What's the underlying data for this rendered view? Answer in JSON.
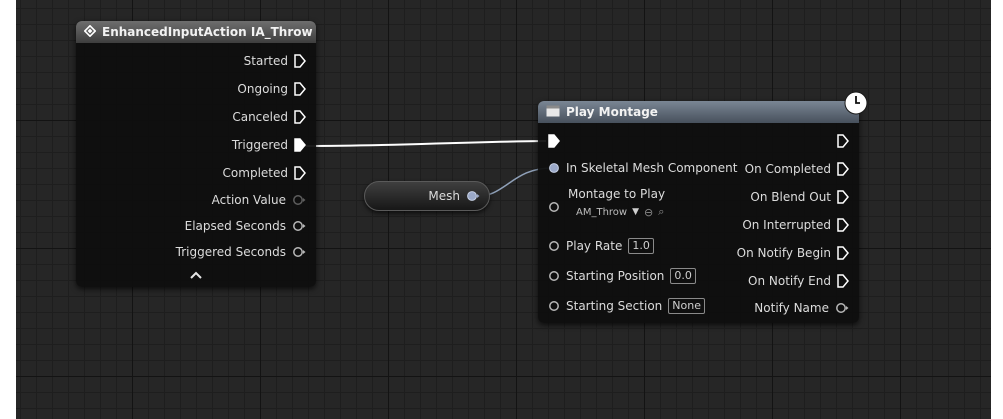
{
  "enhanced_input_node": {
    "title": "EnhancedInputAction IA_Throw",
    "exec_outputs": [
      {
        "label": "Started",
        "connected": false
      },
      {
        "label": "Ongoing",
        "connected": false
      },
      {
        "label": "Canceled",
        "connected": false
      },
      {
        "label": "Triggered",
        "connected": true
      },
      {
        "label": "Completed",
        "connected": false
      }
    ],
    "data_outputs": [
      {
        "label": "Action Value"
      },
      {
        "label": "Elapsed Seconds"
      },
      {
        "label": "Triggered Seconds"
      }
    ],
    "collapse_icon": "chevron-up-icon"
  },
  "mesh_node": {
    "label": "Mesh"
  },
  "play_montage_node": {
    "title": "Play Montage",
    "inputs": {
      "skeletal_mesh": "In Skeletal Mesh Component",
      "montage": {
        "label": "Montage to Play",
        "value": "AM_Throw"
      },
      "play_rate": {
        "label": "Play Rate",
        "value": "1.0"
      },
      "starting_position": {
        "label": "Starting Position",
        "value": "0.0"
      },
      "starting_section": {
        "label": "Starting Section",
        "value": "None"
      }
    },
    "outputs": [
      {
        "label": "On Completed"
      },
      {
        "label": "On Blend Out"
      },
      {
        "label": "On Interrupted"
      },
      {
        "label": "On Notify Begin"
      },
      {
        "label": "On Notify End"
      }
    ],
    "notify_name_output": "Notify Name",
    "latent_icon": "clock-icon"
  },
  "colors": {
    "graph_bg": "#262626",
    "exec_pin": "#ffffff",
    "object_pin": "#9aa8c8",
    "float_pin": "#b8b8b8",
    "wire": "#ffffff",
    "data_wire": "#8fa0b8"
  }
}
